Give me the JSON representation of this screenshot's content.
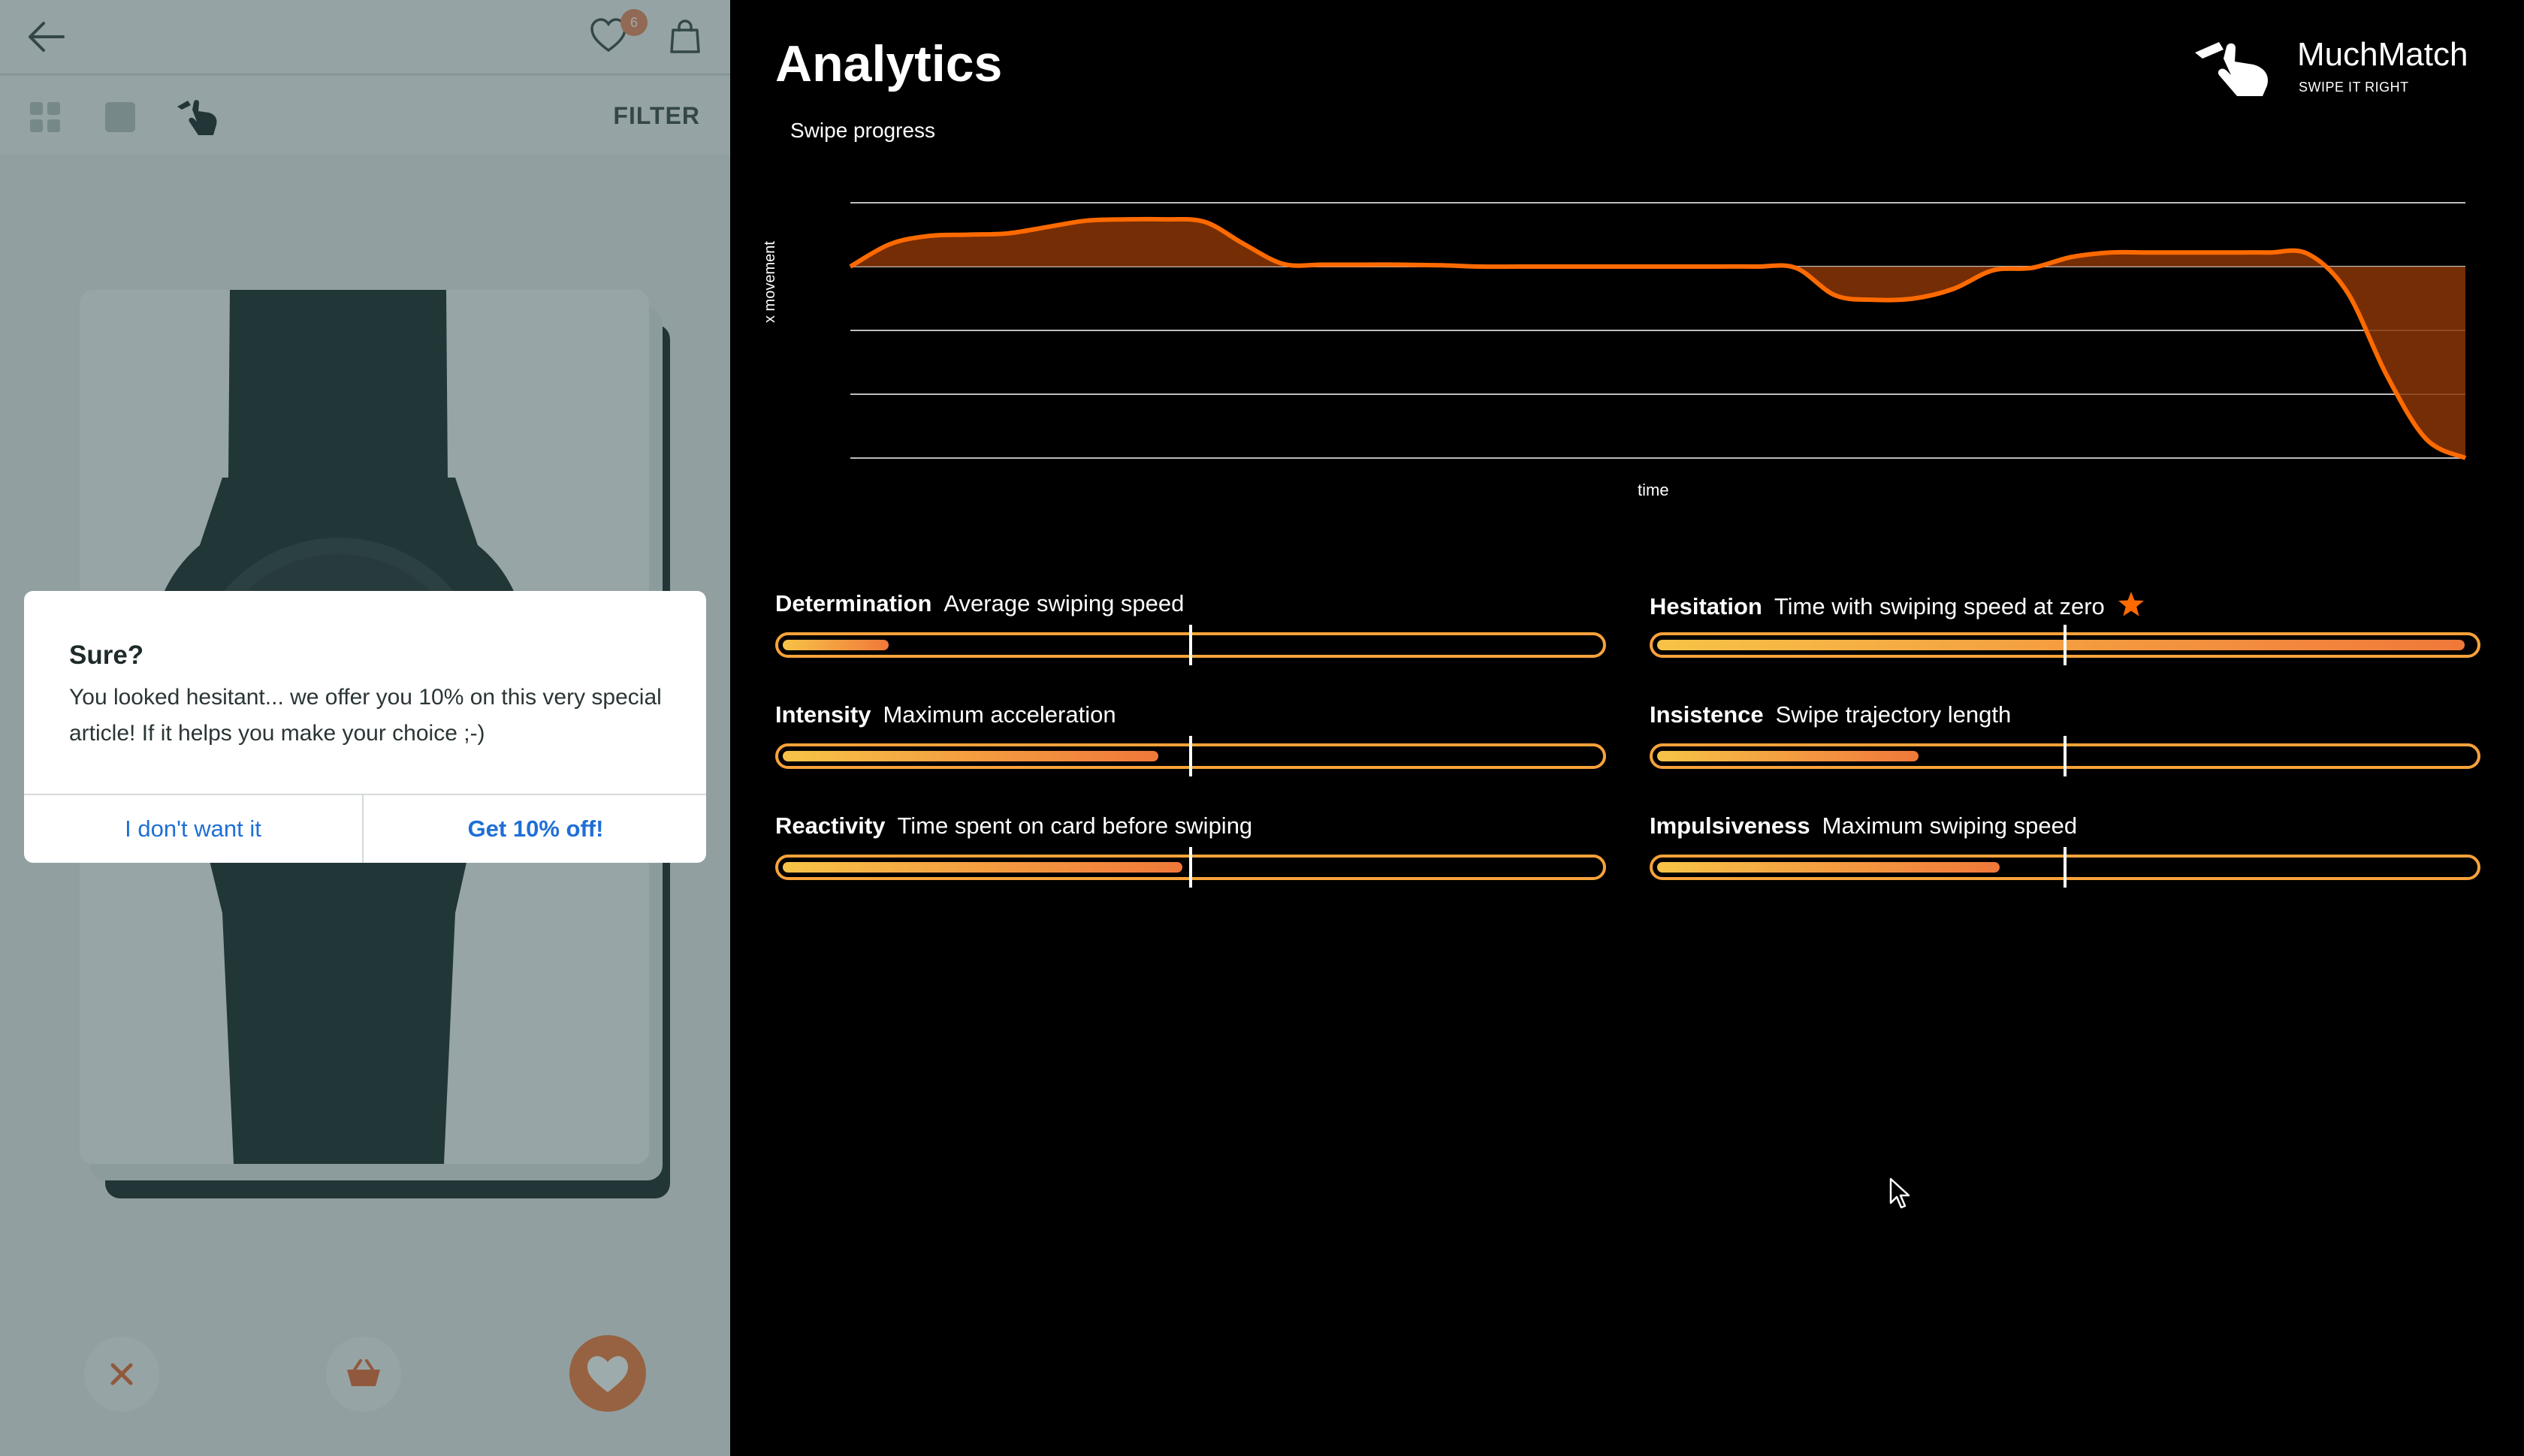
{
  "app": {
    "header": {
      "wishlist_count": "6"
    },
    "toolbar": {
      "filter_label": "FILTER"
    },
    "dialog": {
      "title": "Sure?",
      "message": "You looked hesitant... we offer you 10% on this very special article! If it helps you make your choice ;-)",
      "decline_label": "I don't want it",
      "accept_label": "Get 10% off!"
    },
    "icons": {
      "back": "back-arrow-icon",
      "wishlist": "heart-outline-icon",
      "bag": "shopping-bag-icon",
      "grid": "grid-view-icon",
      "single": "single-view-icon",
      "swipe": "swipe-hand-icon",
      "dislike": "close-icon",
      "cart": "basket-icon",
      "like": "heart-icon"
    },
    "colors": {
      "accent": "#f07a3c",
      "link": "#1f6fd6",
      "badge": "#e8875f"
    }
  },
  "analytics": {
    "title": "Analytics",
    "brand": {
      "name": "MuchMatch",
      "tagline": "SWIPE IT RIGHT"
    },
    "chart_data": {
      "type": "area",
      "title": "Swipe progress",
      "xlabel": "time",
      "ylabel": "x movement",
      "baseline_gridline": 2,
      "gridlines": 5,
      "series": [
        {
          "color": "#ff6a00",
          "x": [
            0,
            1,
            2,
            3,
            4,
            5,
            6,
            7,
            8,
            9,
            10,
            11,
            12,
            13,
            14,
            15,
            16,
            17,
            18,
            19,
            20,
            21,
            22,
            23,
            24,
            25,
            26,
            27,
            28,
            29,
            30,
            31,
            32,
            33,
            34,
            35,
            36,
            37,
            38,
            39,
            40,
            41
          ],
          "y": [
            0,
            0.35,
            0.48,
            0.5,
            0.52,
            0.62,
            0.72,
            0.74,
            0.74,
            0.7,
            0.35,
            0.04,
            0.03,
            0.03,
            0.03,
            0.02,
            0,
            0,
            0,
            0,
            0,
            0,
            0,
            0,
            -0.02,
            -0.45,
            -0.52,
            -0.5,
            -0.35,
            -0.06,
            -0.02,
            0.15,
            0.22,
            0.22,
            0.22,
            0.22,
            0.22,
            0.2,
            -0.4,
            -1.7,
            -2.7,
            -3.0
          ]
        }
      ]
    },
    "metrics": [
      {
        "name": "Determination",
        "desc": "Average swiping speed",
        "value": 0.13,
        "star": false
      },
      {
        "name": "Hesitation",
        "desc": "Time with swiping speed at zero",
        "value": 0.99,
        "star": true
      },
      {
        "name": "Intensity",
        "desc": "Maximum acceleration",
        "value": 0.46,
        "star": false
      },
      {
        "name": "Insistence",
        "desc": "Swipe trajectory length",
        "value": 0.32,
        "star": false
      },
      {
        "name": "Reactivity",
        "desc": "Time spent on card before swiping",
        "value": 0.49,
        "star": false
      },
      {
        "name": "Impulsiveness",
        "desc": "Maximum swiping speed",
        "value": 0.42,
        "star": false
      }
    ],
    "metric_marker": 0.5
  }
}
